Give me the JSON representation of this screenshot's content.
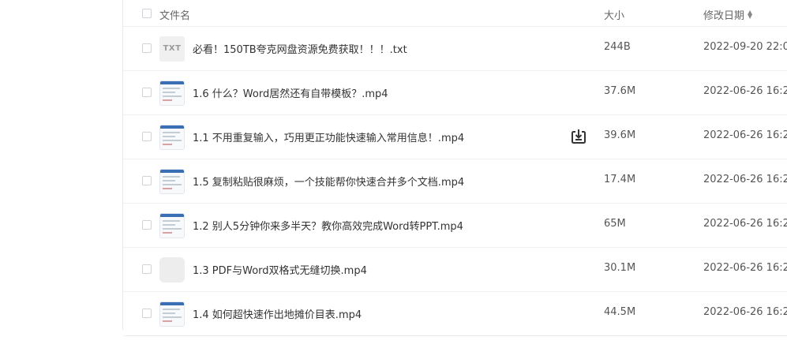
{
  "header": {
    "name_label": "文件名",
    "size_label": "大小",
    "date_label": "修改日期",
    "sort_icon": "sort-updown-icon"
  },
  "files": [
    {
      "name": "必看！150TB夸克网盘资源免费获取！！！.txt",
      "size": "244B",
      "date": "2022-09-20 22:0",
      "thumb_type": "txt",
      "thumb_text": "TXT"
    },
    {
      "name": "1.6 什么？Word居然还有自带模板？.mp4",
      "size": "37.6M",
      "date": "2022-06-26 16:2",
      "thumb_type": "shot"
    },
    {
      "name": "1.1 不用重复输入，巧用更正功能快速输入常用信息！.mp4",
      "size": "39.6M",
      "date": "2022-06-26 16:2",
      "thumb_type": "shot",
      "hover_action": "download-icon"
    },
    {
      "name": "1.5 复制粘贴很麻烦，一个技能帮你快速合并多个文档.mp4",
      "size": "17.4M",
      "date": "2022-06-26 16:2",
      "thumb_type": "shot"
    },
    {
      "name": "1.2 别人5分钟你来多半天？教你高效完成Word转PPT.mp4",
      "size": "65M",
      "date": "2022-06-26 16:2",
      "thumb_type": "shot"
    },
    {
      "name": "1.3 PDF与Word双格式无缝切换.mp4",
      "size": "30.1M",
      "date": "2022-06-26 16:2",
      "thumb_type": "empty"
    },
    {
      "name": "1.4 如何超快速作出地摊价目表.mp4",
      "size": "44.5M",
      "date": "2022-06-26 16:2",
      "thumb_type": "shot"
    }
  ],
  "colors": {
    "text": "#333333",
    "muted": "#666666",
    "divider": "#eeeeee",
    "icon": "#333333"
  }
}
